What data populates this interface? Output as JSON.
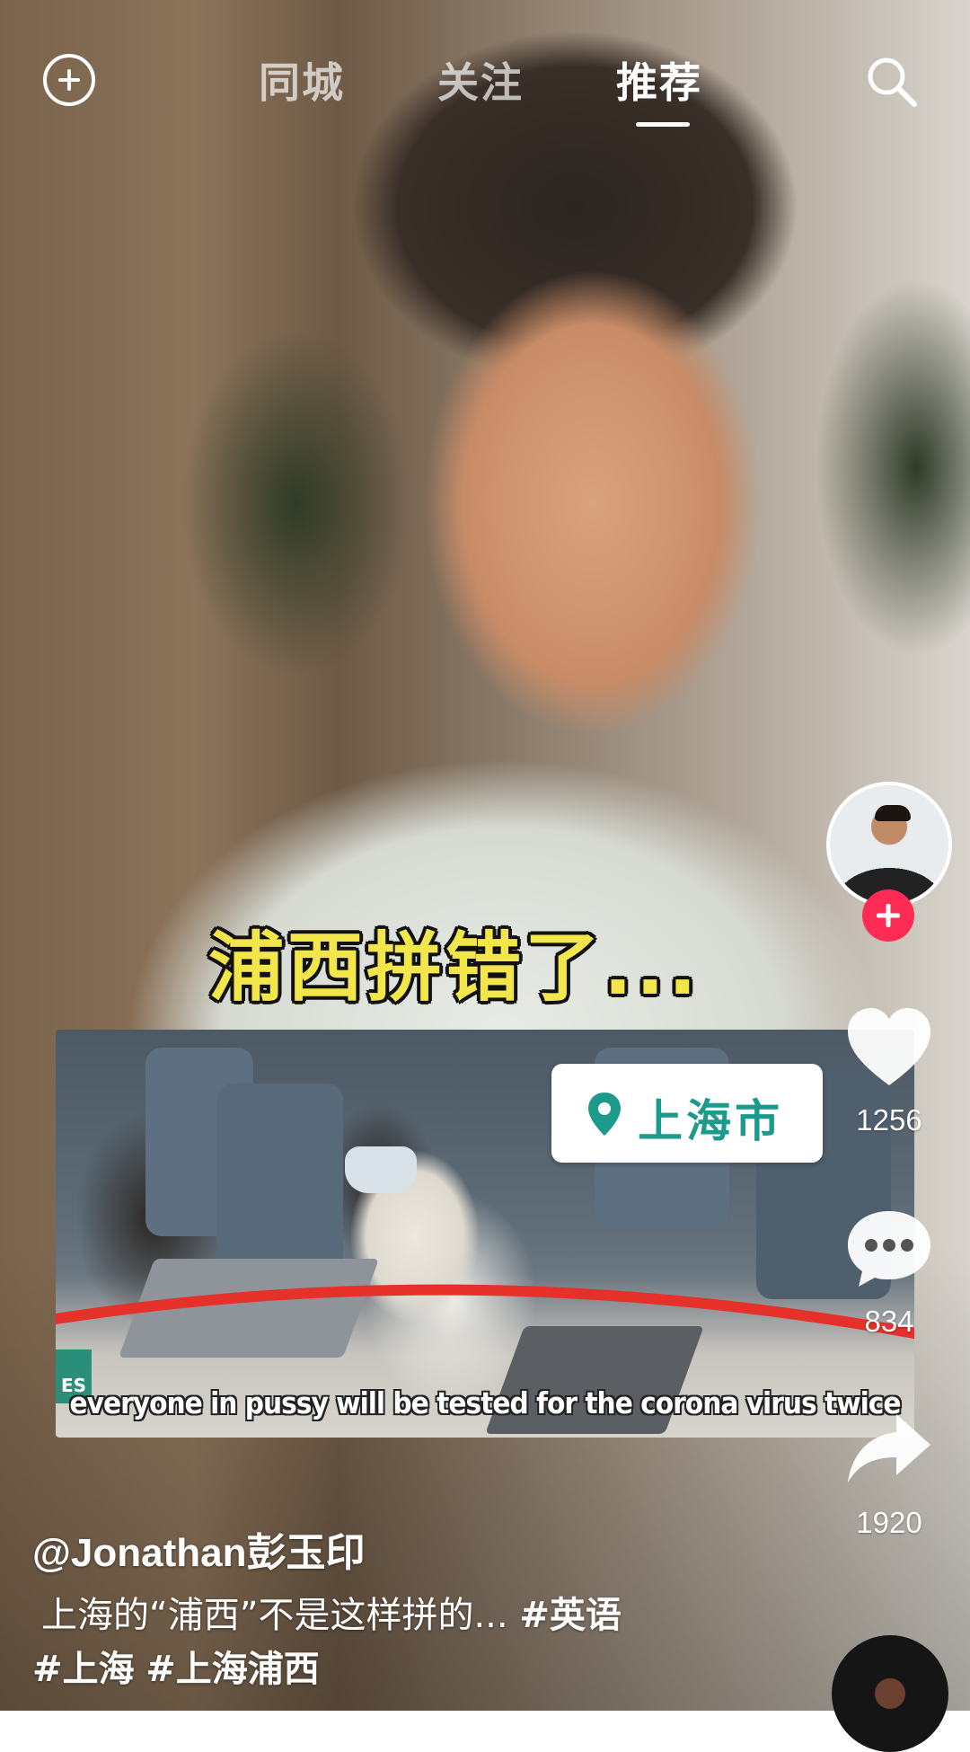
{
  "header": {
    "tabs": [
      {
        "label": "同城",
        "active": false
      },
      {
        "label": "关注",
        "active": false
      },
      {
        "label": "推荐",
        "active": true
      }
    ],
    "add_icon": "plus-circle-icon",
    "search_icon": "search-icon"
  },
  "video": {
    "caption": "浦西拼错了...",
    "embedded_clip": {
      "location_tag": "上海市",
      "subtitle": "everyone in pussy will be tested for the corona virus twice",
      "logo_text": "ES"
    }
  },
  "actions": {
    "like_count": "1256",
    "comment_count": "834",
    "share_count": "1920"
  },
  "post": {
    "author": "@Jonathan彭玉印",
    "description": "上海的“浦西”不是这样拼的...",
    "hashtags": [
      "#英语",
      "#上海",
      "#上海浦西"
    ]
  },
  "colors": {
    "caption_yellow": "#f2e64a",
    "follow_red": "#fe2c55",
    "location_teal": "#1c9a8c",
    "underline_red": "#e5312a"
  }
}
